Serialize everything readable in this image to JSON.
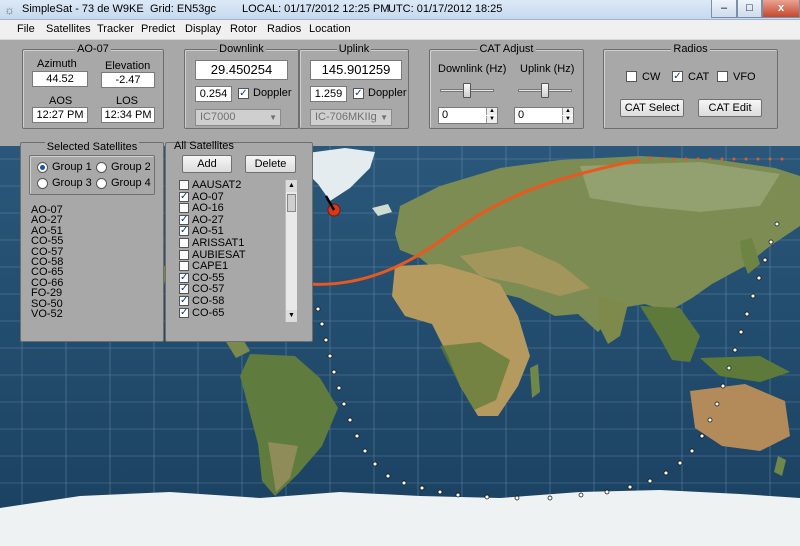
{
  "titlebar": {
    "app": "SimpleSat - 73 de W9KE",
    "grid": "Grid: EN53gc",
    "local": "LOCAL: 01/17/2012 12:25 PM",
    "utc": "UTC: 01/17/2012 18:25",
    "minimize": "–",
    "maximize": "□",
    "close": "x"
  },
  "menu": [
    "File",
    "Satellites",
    "Tracker",
    "Predict",
    "Display",
    "Rotor",
    "Radios",
    "Location"
  ],
  "sat_info": {
    "title": "AO-07",
    "azimuth_label": "Azimuth",
    "azimuth": "44.52",
    "elevation_label": "Elevation",
    "elevation": "-2.47",
    "aos_label": "AOS",
    "aos": "12:27 PM",
    "los_label": "LOS",
    "los": "12:34 PM"
  },
  "downlink": {
    "title": "Downlink",
    "freq": "29.450254",
    "doppler": "0.254",
    "doppler_label": "Doppler",
    "doppler_checked": true,
    "radio": "IC7000"
  },
  "uplink": {
    "title": "Uplink",
    "freq": "145.901259",
    "doppler": "1.259",
    "doppler_label": "Doppler",
    "doppler_checked": true,
    "radio": "IC-706MKIIg"
  },
  "cat_adjust": {
    "title": "CAT Adjust",
    "downlink_label": "Downlink (Hz)",
    "downlink_value": "0",
    "uplink_label": "Uplink (Hz)",
    "uplink_value": "0"
  },
  "radios": {
    "title": "Radios",
    "cw_label": "CW",
    "cw": false,
    "cat_label": "CAT",
    "cat": true,
    "vfo_label": "VFO",
    "vfo": false,
    "cat_select": "CAT Select",
    "cat_edit": "CAT Edit"
  },
  "selected_satellites": {
    "title": "Selected Satellites",
    "groups": [
      {
        "label": "Group 1",
        "selected": true
      },
      {
        "label": "Group 2",
        "selected": false
      },
      {
        "label": "Group 3",
        "selected": false
      },
      {
        "label": "Group 4",
        "selected": false
      }
    ],
    "list": [
      "AO-07",
      "AO-27",
      "AO-51",
      "CO-55",
      "CO-57",
      "CO-58",
      "CO-65",
      "CO-66",
      "FO-29",
      "SO-50",
      "VO-52"
    ]
  },
  "all_satellites": {
    "title": "All Satellites",
    "add": "Add",
    "delete": "Delete",
    "items": [
      {
        "name": "AAUSAT2",
        "checked": false
      },
      {
        "name": "AO-07",
        "checked": true
      },
      {
        "name": "AO-16",
        "checked": false
      },
      {
        "name": "AO-27",
        "checked": true
      },
      {
        "name": "AO-51",
        "checked": true
      },
      {
        "name": "ARISSAT1",
        "checked": false
      },
      {
        "name": "AUBIESAT",
        "checked": false
      },
      {
        "name": "CAPE1",
        "checked": false
      },
      {
        "name": "CO-55",
        "checked": true
      },
      {
        "name": "CO-57",
        "checked": true
      },
      {
        "name": "CO-58",
        "checked": true
      },
      {
        "name": "CO-65",
        "checked": true
      }
    ]
  },
  "colors": {
    "track": "#e8591f",
    "panel": "#a8a8a8",
    "ocean": "#1f4a6e"
  }
}
